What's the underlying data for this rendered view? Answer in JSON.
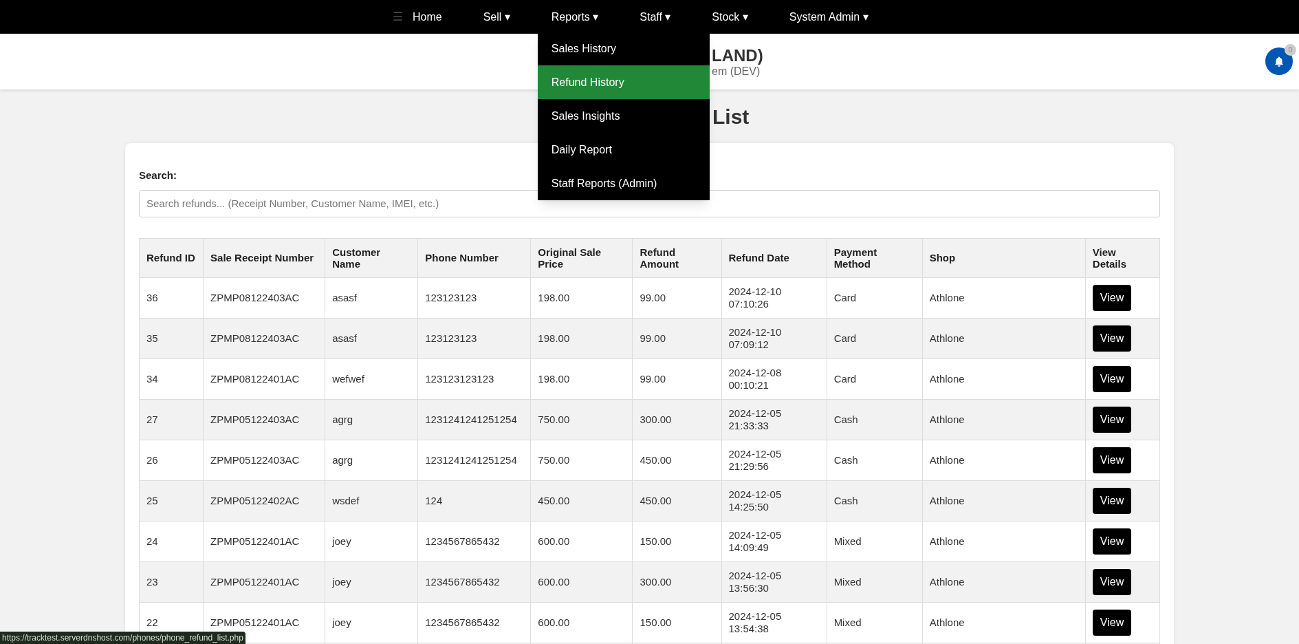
{
  "nav": {
    "menu_icon": "☰",
    "items": [
      {
        "label": "Home"
      },
      {
        "label": "Sell ▾"
      },
      {
        "label": "Reports ▾",
        "menu": [
          {
            "label": "Sales History",
            "selected": false
          },
          {
            "label": "Refund History",
            "selected": true
          },
          {
            "label": "Sales Insights",
            "selected": false
          },
          {
            "label": "Daily Report",
            "selected": false
          },
          {
            "label": "Staff Reports (Admin)",
            "selected": false
          }
        ]
      },
      {
        "label": "Staff ▾"
      },
      {
        "label": "Stock ▾"
      },
      {
        "label": "System Admin ▾"
      }
    ]
  },
  "header": {
    "title": "LAND)",
    "subtitle": "em (DEV)",
    "notifications": {
      "count": "0"
    }
  },
  "page_title": "List",
  "search": {
    "label": "Search:",
    "placeholder": "Search refunds... (Receipt Number, Customer Name, IMEI, etc.)"
  },
  "table": {
    "columns": [
      "Refund ID",
      "Sale Receipt Number",
      "Customer Name",
      "Phone Number",
      "Original Sale Price",
      "Refund Amount",
      "Refund Date",
      "Payment Method",
      "Shop",
      "View Details"
    ],
    "rows": [
      {
        "cells": [
          "36",
          "ZPMP08122403AC",
          "asasf",
          "123123123",
          "198.00",
          "99.00",
          "2024-12-10 07:10:26",
          "Card",
          "Athlone"
        ],
        "action": "View"
      },
      {
        "cells": [
          "35",
          "ZPMP08122403AC",
          "asasf",
          "123123123",
          "198.00",
          "99.00",
          "2024-12-10 07:09:12",
          "Card",
          "Athlone"
        ],
        "action": "View"
      },
      {
        "cells": [
          "34",
          "ZPMP08122401AC",
          "wefwef",
          "123123123123",
          "198.00",
          "99.00",
          "2024-12-08 00:10:21",
          "Card",
          "Athlone"
        ],
        "action": "View"
      },
      {
        "cells": [
          "27",
          "ZPMP05122403AC",
          "agrg",
          "1231241241251254",
          "750.00",
          "300.00",
          "2024-12-05 21:33:33",
          "Cash",
          "Athlone"
        ],
        "action": "View"
      },
      {
        "cells": [
          "26",
          "ZPMP05122403AC",
          "agrg",
          "1231241241251254",
          "750.00",
          "450.00",
          "2024-12-05 21:29:56",
          "Cash",
          "Athlone"
        ],
        "action": "View"
      },
      {
        "cells": [
          "25",
          "ZPMP05122402AC",
          "wsdef",
          "124",
          "450.00",
          "450.00",
          "2024-12-05 14:25:50",
          "Cash",
          "Athlone"
        ],
        "action": "View"
      },
      {
        "cells": [
          "24",
          "ZPMP05122401AC",
          "joey",
          "1234567865432",
          "600.00",
          "150.00",
          "2024-12-05 14:09:49",
          "Mixed",
          "Athlone"
        ],
        "action": "View"
      },
      {
        "cells": [
          "23",
          "ZPMP05122401AC",
          "joey",
          "1234567865432",
          "600.00",
          "300.00",
          "2024-12-05 13:56:30",
          "Mixed",
          "Athlone"
        ],
        "action": "View"
      },
      {
        "cells": [
          "22",
          "ZPMP05122401AC",
          "joey",
          "1234567865432",
          "600.00",
          "150.00",
          "2024-12-05 13:54:38",
          "Mixed",
          "Athlone"
        ],
        "action": "View"
      }
    ]
  },
  "status_bar": {
    "url": "https://tracktest.serverdnshost.com/phones/phone_refund_list.php"
  }
}
